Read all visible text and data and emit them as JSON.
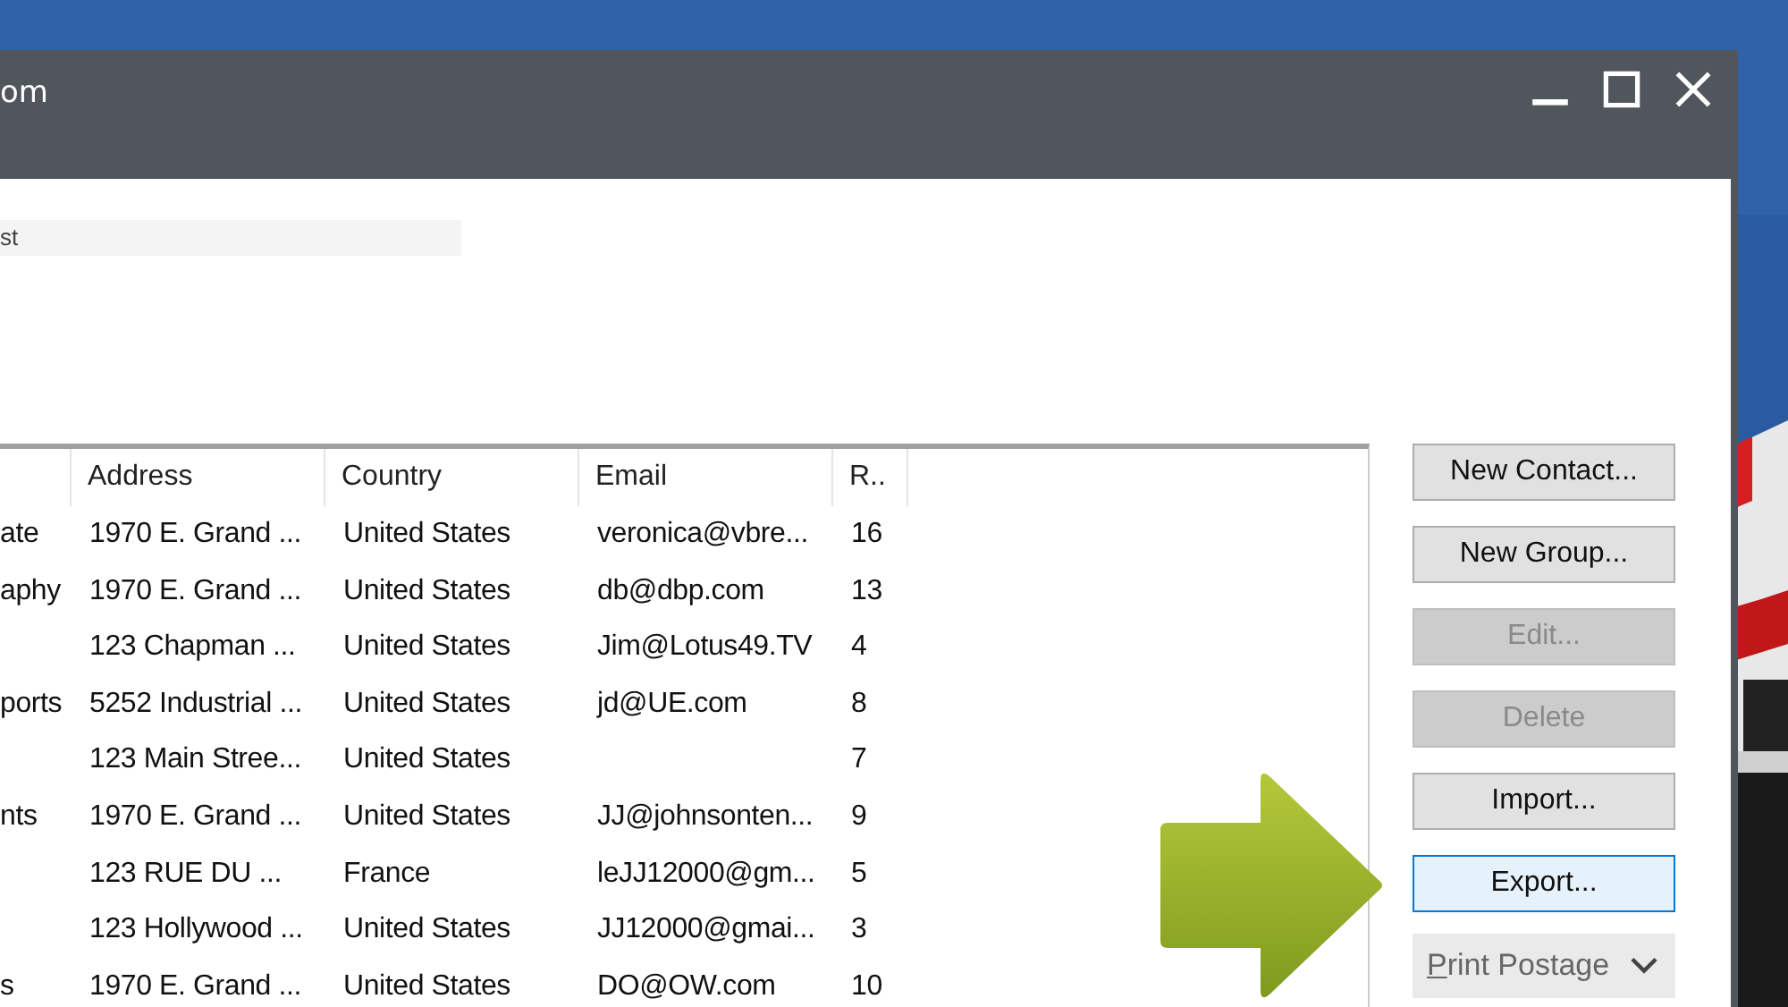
{
  "window": {
    "title": "om"
  },
  "search": {
    "value": "st"
  },
  "table": {
    "columns": [
      "",
      "Address",
      "Country",
      "Email",
      "R.."
    ],
    "rows": [
      {
        "cells": [
          "ate",
          "1970 E. Grand ...",
          "United States",
          "veronica@vbre...",
          "16"
        ]
      },
      {
        "cells": [
          "aphy",
          "1970 E. Grand ...",
          "United States",
          "db@dbp.com",
          "13"
        ]
      },
      {
        "cells": [
          "",
          "123 Chapman ...",
          "United States",
          "Jim@Lotus49.TV",
          "4"
        ]
      },
      {
        "cells": [
          "ports",
          "5252 Industrial ...",
          "United States",
          "jd@UE.com",
          "8"
        ]
      },
      {
        "cells": [
          "",
          "123 Main Stree...",
          "United States",
          "",
          "7"
        ]
      },
      {
        "cells": [
          "nts",
          "1970 E. Grand ...",
          "United States",
          "JJ@johnsonten...",
          "9"
        ]
      },
      {
        "cells": [
          "",
          "123 RUE DU ...",
          "France",
          "leJJ12000@gm...",
          "5"
        ]
      },
      {
        "cells": [
          "",
          "123 Hollywood ...",
          "United States",
          "JJ12000@gmai...",
          "3"
        ]
      },
      {
        "cells": [
          "s",
          "1970 E. Grand ...",
          "United States",
          "DO@OW.com",
          "10"
        ]
      }
    ]
  },
  "buttons": [
    {
      "label": "New Contact...",
      "disabled": false,
      "focused": false
    },
    {
      "label": "New Group...",
      "disabled": false,
      "focused": false
    },
    {
      "label": "Edit...",
      "disabled": true,
      "focused": false
    },
    {
      "label": "Delete",
      "disabled": true,
      "focused": false
    },
    {
      "label": "Import...",
      "disabled": false,
      "focused": false
    },
    {
      "label": "Export...",
      "disabled": false,
      "focused": true
    }
  ],
  "dropdown": {
    "label": "Print Postage"
  }
}
